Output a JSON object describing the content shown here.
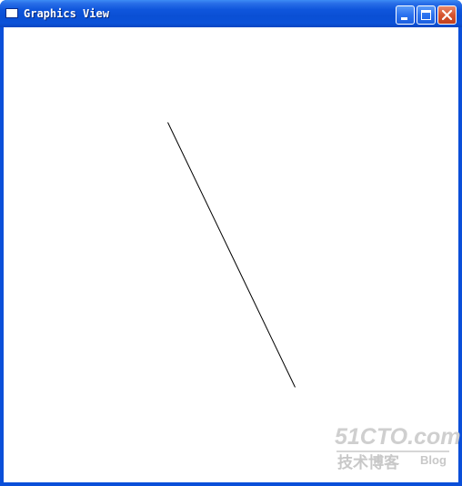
{
  "window": {
    "title": "Graphics View",
    "controls": {
      "minimize": "minimize",
      "maximize": "maximize",
      "close": "close"
    }
  },
  "scene": {
    "items": [
      {
        "kind": "line",
        "color": "#000000"
      }
    ]
  },
  "watermark": {
    "site": "51CTO.com",
    "subtitle": "技术博客",
    "tag": "Blog"
  },
  "colors": {
    "title_bar": "#0a4fd9",
    "close_button": "#d6542f",
    "canvas_background": "#ffffff",
    "line": "#000000",
    "watermark": "#cfcfcf"
  }
}
